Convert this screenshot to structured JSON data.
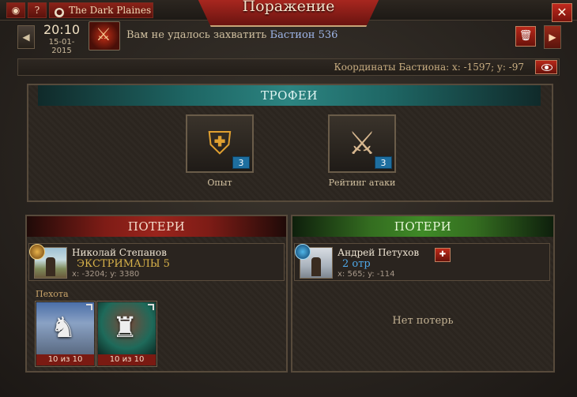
{
  "window": {
    "title": "Поражение",
    "server_name": "The Dark Plaines"
  },
  "topbar": {
    "camera_icon": "camera-icon",
    "help_icon": "question-icon",
    "globe_icon": "globe-icon"
  },
  "notification": {
    "time": "20:10",
    "date": "15-01-2015",
    "message_prefix": "Вам не удалось захватить",
    "message_target": "Бастион 536",
    "event_icon": "swords-icon"
  },
  "coords_bar": {
    "text": "Координаты Бастиона: x: -1597; y: -97"
  },
  "trophies": {
    "header": "ТРОФЕИ",
    "items": [
      {
        "label": "Опыт",
        "count": "3",
        "icon": "shield-medal-icon"
      },
      {
        "label": "Рейтинг атаки",
        "count": "3",
        "icon": "crossed-swords-icon"
      }
    ]
  },
  "losses_left": {
    "header": "ПОТЕРИ",
    "player_name": "Николай Степанов",
    "guild": "ЭКСТРИМАЛЫ 5",
    "coords": "x: -3204; y: 3380",
    "section_label": "Пехота",
    "units": [
      {
        "count": "10 из 10",
        "icon": "knight-icon"
      },
      {
        "count": "10 из 10",
        "icon": "orc-warrior-icon"
      }
    ]
  },
  "losses_right": {
    "header": "ПОТЕРИ",
    "player_name": "Андрей Петухов",
    "guild": "2 отр",
    "coords": "x: 565; y: -114",
    "empty_text": "Нет потерь"
  },
  "colors": {
    "accent_red": "#9a241c",
    "teal_header": "#2c8481",
    "green_header": "#3f8a27",
    "guild_gold": "#d8b24a",
    "guild_blue": "#4fa8e8"
  }
}
